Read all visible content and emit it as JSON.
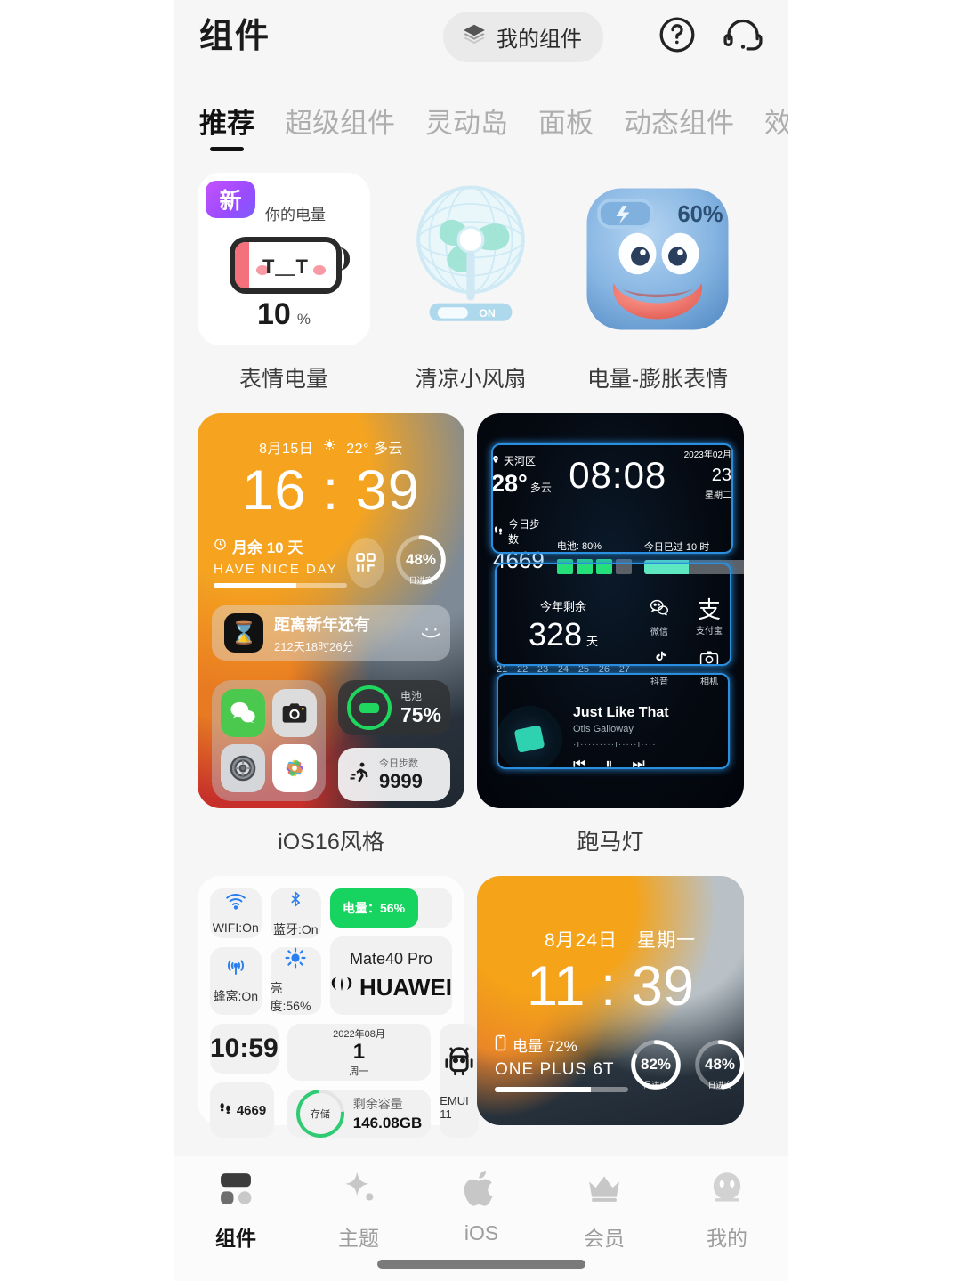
{
  "header": {
    "title": "组件",
    "mine_button": "我的组件",
    "mine_icon": "layers-icon",
    "help_icon": "question-circle-icon",
    "support_icon": "headset-icon"
  },
  "tabs": [
    {
      "label": "推荐",
      "active": true
    },
    {
      "label": "超级组件",
      "active": false
    },
    {
      "label": "灵动岛",
      "active": false
    },
    {
      "label": "面板",
      "active": false
    },
    {
      "label": "动态组件",
      "active": false
    },
    {
      "label": "效",
      "active": false
    }
  ],
  "row1": {
    "emoji_battery": {
      "label": "表情电量",
      "badge": "新",
      "caption": "你的电量",
      "face": "T＿T",
      "value": "10",
      "unit": "%"
    },
    "fan": {
      "label": "清凉小风扇",
      "toggle": "ON"
    },
    "face_battery": {
      "label": "电量-膨胀表情",
      "percent": "60%"
    }
  },
  "row2": {
    "ios16": {
      "label": "iOS16风格",
      "date": "8月15日",
      "weather": "22° 多云",
      "time": "16 : 39",
      "moon_text": "月余 10 天",
      "tagline": "HAVE NICE DAY",
      "ring_value": "48%",
      "ring_caption": "日进度",
      "countdown_title": "距离新年还有",
      "countdown_sub": "212天18时26分",
      "battery_caption": "电池",
      "battery_value": "75%",
      "steps_caption": "今日步数",
      "steps_value": "9999"
    },
    "marquee": {
      "label": "跑马灯",
      "location": "天河区",
      "temp": "28°",
      "weather": "多云",
      "time": "08:08",
      "date_ym": "2023年02月",
      "date_day": "23",
      "weekday": "星期二",
      "steps_caption": "今日步数",
      "steps_value": "4669",
      "battery_caption": "电池: 80%",
      "day_caption": "今日已过 10 时",
      "year_caption": "今年剩余",
      "year_value": "328",
      "year_unit": "天",
      "day_numbers": [
        "21",
        "22",
        "23",
        "24",
        "25",
        "26",
        "27"
      ],
      "apps": [
        {
          "name": "微信",
          "icon": "wechat-icon"
        },
        {
          "name": "支付宝",
          "icon": "alipay-icon"
        },
        {
          "name": "抖音",
          "icon": "tiktok-icon"
        },
        {
          "name": "相机",
          "icon": "camera-icon"
        }
      ],
      "song_title": "Just Like That",
      "song_artist": "Otis Galloway"
    }
  },
  "row3": {
    "panel": {
      "tiles": [
        {
          "icon": "wifi-icon",
          "text": "WIFI:On"
        },
        {
          "icon": "bluetooth-icon",
          "text": "蓝牙:On"
        },
        {
          "icon": "cellular-icon",
          "text": "蜂窝:On"
        },
        {
          "icon": "brightness-icon",
          "text": "亮度:56%"
        }
      ],
      "battery_bar": "电量：56%",
      "device_model": "Mate40 Pro",
      "device_brand": "HUAWEI",
      "clock": "10:59",
      "date_ym": "2022年08月",
      "date_day": "1",
      "weekday": "周一",
      "steps": "4669",
      "storage_ring": "存储",
      "storage_caption": "剩余容量",
      "storage_value": "146.08GB",
      "os_version": "EMUI 11"
    },
    "lock": {
      "date": "8月24日",
      "weekday": "星期一",
      "time": "11 : 39",
      "battery_caption": "电量 72%",
      "device": "ONE PLUS 6T",
      "ring1_value": "82%",
      "ring1_caption": "月进度",
      "ring2_value": "48%",
      "ring2_caption": "日进度"
    }
  },
  "bottom_nav": [
    {
      "label": "组件",
      "icon": "widgets-icon",
      "active": true
    },
    {
      "label": "主题",
      "icon": "sparkle-icon",
      "active": false
    },
    {
      "label": "iOS",
      "icon": "apple-icon",
      "active": false
    },
    {
      "label": "会员",
      "icon": "crown-icon",
      "active": false
    },
    {
      "label": "我的",
      "icon": "face-icon",
      "active": false
    }
  ],
  "colors": {
    "accent_new_badge": "#a14bff",
    "battery_green": "#16d45f",
    "neon_blue": "#2b8fe0",
    "bg": "#f6f6f6"
  }
}
